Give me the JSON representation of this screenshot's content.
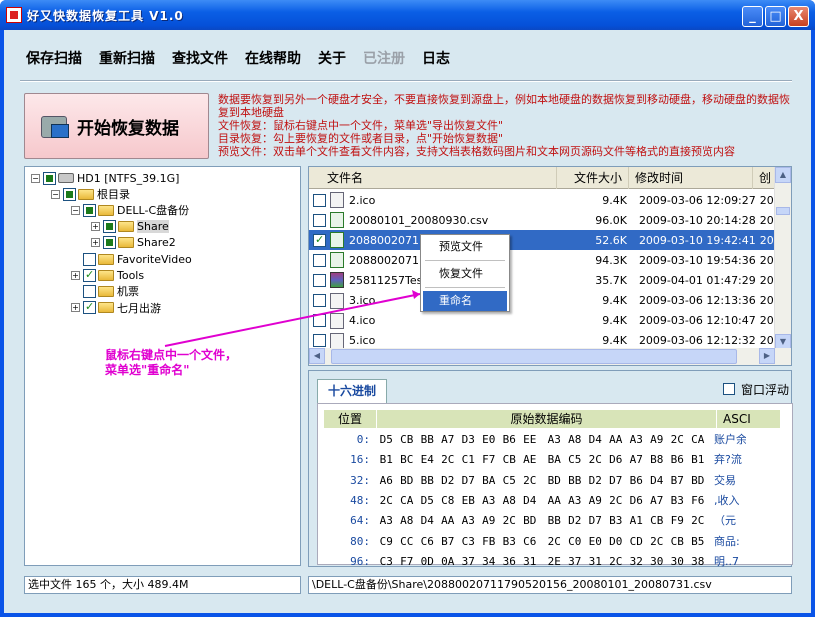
{
  "window": {
    "title": "好又快数据恢复工具 V1.0",
    "min": "_",
    "max": "□",
    "close": "X"
  },
  "menu": [
    {
      "label": "保存扫描",
      "disabled": false
    },
    {
      "label": "重新扫描",
      "disabled": false
    },
    {
      "label": "查找文件",
      "disabled": false
    },
    {
      "label": "在线帮助",
      "disabled": false
    },
    {
      "label": "关于",
      "disabled": false
    },
    {
      "label": "已注册",
      "disabled": true
    },
    {
      "label": "日志",
      "disabled": false
    }
  ],
  "start_button": "开始恢复数据",
  "description": [
    "数据要恢复到另外一个硬盘才安全，不要直接恢复到源盘上，例如本地硬盘的数据恢复到移动硬盘，移动硬盘的数据恢复到本地硬盘",
    "文件恢复：鼠标右键点中一个文件，菜单选\"导出恢复文件\"",
    "目录恢复：勾上要恢复的文件或者目录，点\"开始恢复数据\"",
    "预览文件：双击单个文件查看文件内容，支持文档表格数码图片和文本网页源码文件等格式的直接预览内容"
  ],
  "tree": [
    {
      "label": "HD1  [NTFS_39.1G]",
      "exp": "-",
      "check": "partial",
      "icon": "drive"
    },
    {
      "label": "根目录",
      "exp": "-",
      "check": "partial",
      "icon": "folder"
    },
    {
      "label": "DELL-C盘备份",
      "exp": "-",
      "check": "partial",
      "icon": "folder"
    },
    {
      "label": "Share",
      "exp": "+",
      "check": "partial",
      "icon": "folder",
      "selected": true
    },
    {
      "label": "Share2",
      "exp": "+",
      "check": "partial",
      "icon": "folder"
    },
    {
      "label": "FavoriteVideo",
      "exp": "",
      "check": "none",
      "icon": "folder"
    },
    {
      "label": "Tools",
      "exp": "+",
      "check": "checked",
      "icon": "folder"
    },
    {
      "label": "机票",
      "exp": "",
      "check": "none",
      "icon": "folder"
    },
    {
      "label": "七月出游",
      "exp": "+",
      "check": "checked",
      "icon": "folder"
    }
  ],
  "file_columns": [
    "文件名",
    "文件大小",
    "修改时间",
    "创"
  ],
  "files": [
    {
      "name": "2.ico",
      "size": "9.4K",
      "time": "2009-03-06 12:09:27",
      "cre": "20",
      "checked": false,
      "icon": "ico"
    },
    {
      "name": "20080101_20080930.csv",
      "size": "96.0K",
      "time": "2009-03-10 20:14:28",
      "cre": "20",
      "checked": false,
      "icon": "xls"
    },
    {
      "name": "208800207117...01_2008",
      "size": "52.6K",
      "time": "2009-03-10 19:42:41",
      "cre": "20",
      "checked": true,
      "icon": "xls",
      "selected": true
    },
    {
      "name": "208800207117...01_2008",
      "size": "94.3K",
      "time": "2009-03-10 19:54:36",
      "cre": "20",
      "checked": false,
      "icon": "xls"
    },
    {
      "name": "25811257Test",
      "size": "35.7K",
      "time": "2009-04-01 01:47:29",
      "cre": "20",
      "checked": false,
      "icon": "rar"
    },
    {
      "name": "3.ico",
      "size": "9.4K",
      "time": "2009-03-06 12:13:36",
      "cre": "20",
      "checked": false,
      "icon": "ico"
    },
    {
      "name": "4.ico",
      "size": "9.4K",
      "time": "2009-03-06 12:10:47",
      "cre": "20",
      "checked": false,
      "icon": "ico"
    },
    {
      "name": "5.ico",
      "size": "9.4K",
      "time": "2009-03-06 12:12:32",
      "cre": "20",
      "checked": false,
      "icon": "ico"
    }
  ],
  "context_menu": [
    "预览文件",
    "恢复文件",
    "重命名"
  ],
  "annotation": [
    "鼠标右键点中一个文件，",
    "菜单选\"重命名\""
  ],
  "hex": {
    "tab": "十六进制",
    "float_label": "窗口浮动",
    "headers": [
      "位置",
      "原始数据编码",
      "ASCI"
    ],
    "rows": [
      {
        "pos": "0:",
        "bytes": [
          "D5",
          "CB",
          "BB",
          "A7",
          "D3",
          "E0",
          "B6",
          "EE",
          "A3",
          "A8",
          "D4",
          "AA",
          "A3",
          "A9",
          "2C",
          "CA"
        ],
        "ascii": "账户余"
      },
      {
        "pos": "16:",
        "bytes": [
          "B1",
          "BC",
          "E4",
          "2C",
          "C1",
          "F7",
          "CB",
          "AE",
          "BA",
          "C5",
          "2C",
          "D6",
          "A7",
          "B8",
          "B6",
          "B1"
        ],
        "ascii": "弃?流"
      },
      {
        "pos": "32:",
        "bytes": [
          "A6",
          "BD",
          "BB",
          "D2",
          "D7",
          "BA",
          "C5",
          "2C",
          "BD",
          "BB",
          "D2",
          "D7",
          "B6",
          "D4",
          "B7",
          "BD"
        ],
        "ascii": "交易"
      },
      {
        "pos": "48:",
        "bytes": [
          "2C",
          "CA",
          "D5",
          "C8",
          "EB",
          "A3",
          "A8",
          "D4",
          "AA",
          "A3",
          "A9",
          "2C",
          "D6",
          "A7",
          "B3",
          "F6"
        ],
        "ascii": ",收入"
      },
      {
        "pos": "64:",
        "bytes": [
          "A3",
          "A8",
          "D4",
          "AA",
          "A3",
          "A9",
          "2C",
          "BD",
          "BB",
          "D2",
          "D7",
          "B3",
          "A1",
          "CB",
          "F9",
          "2C"
        ],
        "ascii": "（元"
      },
      {
        "pos": "80:",
        "bytes": [
          "C9",
          "CC",
          "C6",
          "B7",
          "C3",
          "FB",
          "B3",
          "C6",
          "2C",
          "C0",
          "E0",
          "D0",
          "CD",
          "2C",
          "CB",
          "B5"
        ],
        "ascii": "商品:"
      },
      {
        "pos": "96:",
        "bytes": [
          "C3",
          "F7",
          "0D",
          "0A",
          "37",
          "34",
          "36",
          "31",
          "2E",
          "37",
          "31",
          "2C",
          "32",
          "30",
          "30",
          "38"
        ],
        "ascii": "明..7"
      },
      {
        "pos": "112:",
        "bytes": [
          "2D",
          "30",
          "31",
          "2D",
          "30",
          "31",
          "20",
          "30",
          "30",
          "3A",
          "30",
          "30",
          "3A",
          "30",
          "30",
          "2C"
        ],
        "ascii": "-01-0"
      }
    ]
  },
  "status": {
    "left": "选中文件 165 个，大小 489.4M",
    "right": "\\DELL-C盘备份\\Share\\20880020711790520156_20080101_20080731.csv"
  }
}
